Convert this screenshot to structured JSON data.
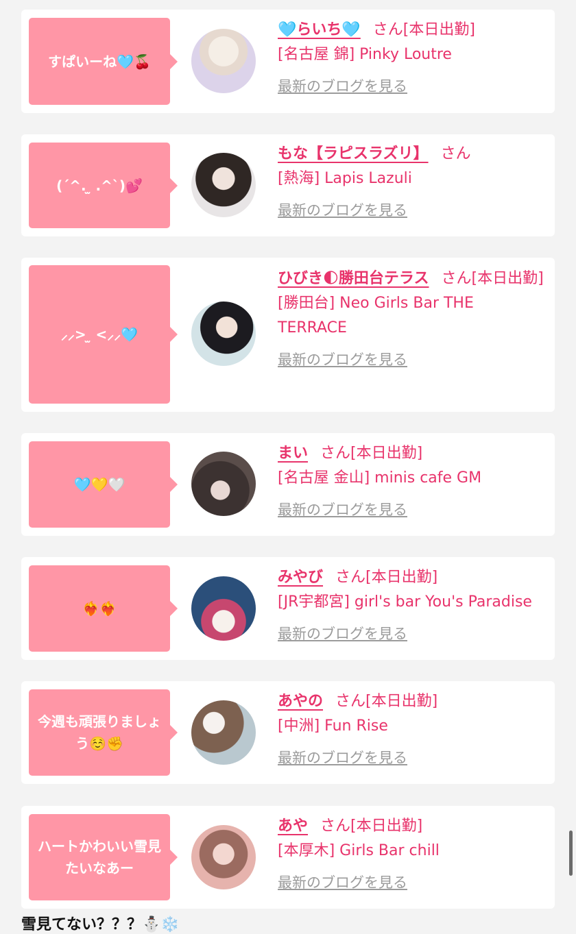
{
  "cards": [
    {
      "bubble": "すぱいーね🩵🍒",
      "name": "🩵らいち🩵",
      "suffix": "さん[本日出勤]",
      "shop": "[名古屋 錦] Pinky Loutre",
      "blog": "最新のブログを見る",
      "avatar_colors": [
        "#ece6f0",
        "#f3e9df"
      ]
    },
    {
      "bubble": "(ˊ^. ̫ .^ˋ)💕",
      "name": "もな【ラピスラズリ】",
      "suffix": "さん",
      "shop": "[熱海] Lapis Lazuli",
      "blog": "最新のブログを見る",
      "avatar_colors": [
        "#e9e3e0",
        "#3a302d"
      ]
    },
    {
      "bubble": "⸝⸝> ̫ <⸝⸝🩵",
      "name": "ひびき🌓勝田台テラス",
      "suffix": "さん[本日出勤]",
      "shop": "[勝田台] Neo Girls Bar THE TERRACE",
      "blog": "最新のブログを見る",
      "avatar_colors": [
        "#dfe9ec",
        "#1e1d22"
      ]
    },
    {
      "bubble": "🩵💛🤍",
      "name": "まい",
      "suffix": "さん[本日出勤]",
      "shop": "[名古屋 金山] minis cafe GM",
      "blog": "最新のブログを見る",
      "avatar_colors": [
        "#4a3f3e",
        "#26201f"
      ]
    },
    {
      "bubble": "❤️‍🔥❤️‍🔥",
      "name": "みやび",
      "suffix": "さん[本日出勤]",
      "shop": "[JR宇都宮] girl's bar You's Paradise",
      "blog": "最新のブログを見る",
      "avatar_colors": [
        "#2b4f7a",
        "#c7476f"
      ]
    },
    {
      "bubble": "今週も頑張りましょう☺️✊",
      "name": "あやの",
      "suffix": "さん[本日出勤]",
      "shop": "[中洲] Fun Rise",
      "blog": "最新のブログを見る",
      "avatar_colors": [
        "#b9c8cf",
        "#7d6150"
      ]
    },
    {
      "bubble": "ハートかわいい雪見たいなあー",
      "name": "あや",
      "suffix": "さん[本日出勤]",
      "shop": "[本厚木] Girls Bar chill",
      "blog": "最新のブログを見る",
      "avatar_colors": [
        "#e9b9b2",
        "#7a5047"
      ]
    }
  ],
  "footer_text": "雪見てない？？？⛄❄️",
  "colors": {
    "accent": "#e8336b",
    "bubble": "#ff96a6",
    "link_gray": "#9b9b9b",
    "background": "#f3f3f3"
  }
}
